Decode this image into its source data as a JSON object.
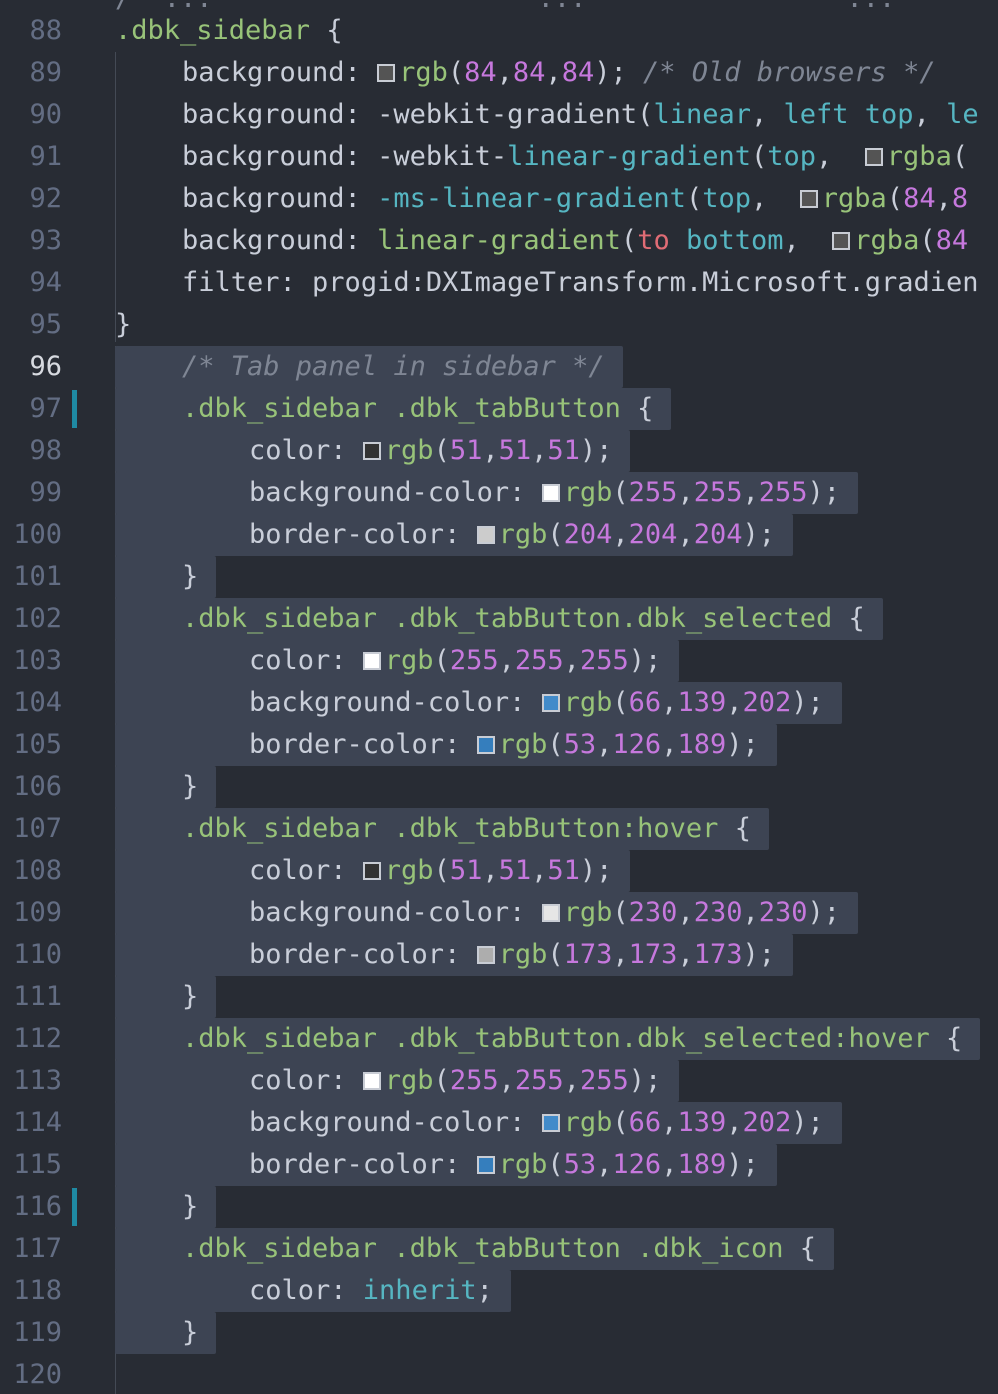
{
  "editor": {
    "top_partial_text": "/* ...                    ...                ...",
    "current_line": 96,
    "lines": [
      {
        "n": 88,
        "indent": 0,
        "sel": false,
        "mark": false,
        "tokens": [
          [
            "sel",
            ".dbk_sidebar"
          ],
          [
            "punc",
            " {"
          ]
        ]
      },
      {
        "n": 89,
        "indent": 1,
        "sel": false,
        "mark": false,
        "tokens": [
          [
            "prop",
            "background: "
          ],
          [
            "sw",
            "#545454"
          ],
          [
            "fn",
            "rgb"
          ],
          [
            "punc",
            "("
          ],
          [
            "num",
            "84"
          ],
          [
            "punc",
            ","
          ],
          [
            "num",
            "84"
          ],
          [
            "punc",
            ","
          ],
          [
            "num",
            "84"
          ],
          [
            "punc",
            ");"
          ],
          [
            "plain",
            " "
          ],
          [
            "cm",
            "/* Old browsers */"
          ]
        ]
      },
      {
        "n": 90,
        "indent": 1,
        "sel": false,
        "mark": false,
        "tokens": [
          [
            "prop",
            "background: "
          ],
          [
            "plain",
            "-webkit-gradient"
          ],
          [
            "punc",
            "("
          ],
          [
            "kw",
            "linear"
          ],
          [
            "punc",
            ", "
          ],
          [
            "kw",
            "left"
          ],
          [
            "plain",
            " "
          ],
          [
            "kw",
            "top"
          ],
          [
            "punc",
            ", "
          ],
          [
            "kw",
            "le"
          ]
        ]
      },
      {
        "n": 91,
        "indent": 1,
        "sel": false,
        "mark": false,
        "tokens": [
          [
            "prop",
            "background: "
          ],
          [
            "plain",
            "-webkit-"
          ],
          [
            "kw",
            "linear-gradient"
          ],
          [
            "punc",
            "("
          ],
          [
            "kw",
            "top"
          ],
          [
            "punc",
            ",  "
          ],
          [
            "sw",
            "#545454"
          ],
          [
            "fn",
            "rgba"
          ],
          [
            "punc",
            "("
          ]
        ]
      },
      {
        "n": 92,
        "indent": 1,
        "sel": false,
        "mark": false,
        "tokens": [
          [
            "prop",
            "background: "
          ],
          [
            "kw",
            "-ms-linear-gradient"
          ],
          [
            "punc",
            "("
          ],
          [
            "kw",
            "top"
          ],
          [
            "punc",
            ",  "
          ],
          [
            "sw",
            "#545454"
          ],
          [
            "fn",
            "rgba"
          ],
          [
            "punc",
            "("
          ],
          [
            "num",
            "84"
          ],
          [
            "punc",
            ","
          ],
          [
            "num",
            "8"
          ]
        ]
      },
      {
        "n": 93,
        "indent": 1,
        "sel": false,
        "mark": false,
        "tokens": [
          [
            "prop",
            "background: "
          ],
          [
            "fn",
            "linear-gradient"
          ],
          [
            "punc",
            "("
          ],
          [
            "to",
            "to"
          ],
          [
            "plain",
            " "
          ],
          [
            "kw",
            "bottom"
          ],
          [
            "punc",
            ",  "
          ],
          [
            "sw",
            "#545454"
          ],
          [
            "fn",
            "rgba"
          ],
          [
            "punc",
            "("
          ],
          [
            "num",
            "84"
          ]
        ]
      },
      {
        "n": 94,
        "indent": 1,
        "sel": false,
        "mark": false,
        "tokens": [
          [
            "prop",
            "filter: "
          ],
          [
            "plain",
            "progid:DXImageTransform.Microsoft.gradien"
          ]
        ]
      },
      {
        "n": 95,
        "indent": 0,
        "sel": false,
        "mark": false,
        "tokens": [
          [
            "punc",
            "}"
          ]
        ]
      },
      {
        "n": 96,
        "indent": 1,
        "sel": true,
        "mark": false,
        "tokens": [
          [
            "cm",
            "/* Tab panel in sidebar */"
          ]
        ]
      },
      {
        "n": 97,
        "indent": 1,
        "sel": true,
        "mark": true,
        "tokens": [
          [
            "sel",
            ".dbk_sidebar .dbk_tabButton"
          ],
          [
            "punc",
            " {"
          ]
        ]
      },
      {
        "n": 98,
        "indent": 2,
        "sel": true,
        "mark": false,
        "tokens": [
          [
            "prop",
            "color: "
          ],
          [
            "sw",
            "#333333"
          ],
          [
            "fn",
            "rgb"
          ],
          [
            "punc",
            "("
          ],
          [
            "num",
            "51"
          ],
          [
            "punc",
            ","
          ],
          [
            "num",
            "51"
          ],
          [
            "punc",
            ","
          ],
          [
            "num",
            "51"
          ],
          [
            "punc",
            ");"
          ]
        ]
      },
      {
        "n": 99,
        "indent": 2,
        "sel": true,
        "mark": false,
        "tokens": [
          [
            "prop",
            "background-color: "
          ],
          [
            "sw",
            "#ffffff"
          ],
          [
            "fn",
            "rgb"
          ],
          [
            "punc",
            "("
          ],
          [
            "num",
            "255"
          ],
          [
            "punc",
            ","
          ],
          [
            "num",
            "255"
          ],
          [
            "punc",
            ","
          ],
          [
            "num",
            "255"
          ],
          [
            "punc",
            ");"
          ]
        ]
      },
      {
        "n": 100,
        "indent": 2,
        "sel": true,
        "mark": false,
        "tokens": [
          [
            "prop",
            "border-color: "
          ],
          [
            "sw",
            "#cccccc"
          ],
          [
            "fn",
            "rgb"
          ],
          [
            "punc",
            "("
          ],
          [
            "num",
            "204"
          ],
          [
            "punc",
            ","
          ],
          [
            "num",
            "204"
          ],
          [
            "punc",
            ","
          ],
          [
            "num",
            "204"
          ],
          [
            "punc",
            ");"
          ]
        ]
      },
      {
        "n": 101,
        "indent": 1,
        "sel": true,
        "mark": false,
        "tokens": [
          [
            "punc",
            "}"
          ]
        ]
      },
      {
        "n": 102,
        "indent": 1,
        "sel": true,
        "mark": false,
        "tokens": [
          [
            "sel",
            ".dbk_sidebar .dbk_tabButton.dbk_selected"
          ],
          [
            "punc",
            " {"
          ]
        ]
      },
      {
        "n": 103,
        "indent": 2,
        "sel": true,
        "mark": false,
        "tokens": [
          [
            "prop",
            "color: "
          ],
          [
            "sw",
            "#ffffff"
          ],
          [
            "fn",
            "rgb"
          ],
          [
            "punc",
            "("
          ],
          [
            "num",
            "255"
          ],
          [
            "punc",
            ","
          ],
          [
            "num",
            "255"
          ],
          [
            "punc",
            ","
          ],
          [
            "num",
            "255"
          ],
          [
            "punc",
            ");"
          ]
        ]
      },
      {
        "n": 104,
        "indent": 2,
        "sel": true,
        "mark": false,
        "tokens": [
          [
            "prop",
            "background-color: "
          ],
          [
            "sw",
            "#428bca"
          ],
          [
            "fn",
            "rgb"
          ],
          [
            "punc",
            "("
          ],
          [
            "num",
            "66"
          ],
          [
            "punc",
            ","
          ],
          [
            "num",
            "139"
          ],
          [
            "punc",
            ","
          ],
          [
            "num",
            "202"
          ],
          [
            "punc",
            ");"
          ]
        ]
      },
      {
        "n": 105,
        "indent": 2,
        "sel": true,
        "mark": false,
        "tokens": [
          [
            "prop",
            "border-color: "
          ],
          [
            "sw",
            "#357ebd"
          ],
          [
            "fn",
            "rgb"
          ],
          [
            "punc",
            "("
          ],
          [
            "num",
            "53"
          ],
          [
            "punc",
            ","
          ],
          [
            "num",
            "126"
          ],
          [
            "punc",
            ","
          ],
          [
            "num",
            "189"
          ],
          [
            "punc",
            ");"
          ]
        ]
      },
      {
        "n": 106,
        "indent": 1,
        "sel": true,
        "mark": false,
        "tokens": [
          [
            "punc",
            "}"
          ]
        ]
      },
      {
        "n": 107,
        "indent": 1,
        "sel": true,
        "mark": false,
        "tokens": [
          [
            "sel",
            ".dbk_sidebar .dbk_tabButton:hover"
          ],
          [
            "punc",
            " {"
          ]
        ]
      },
      {
        "n": 108,
        "indent": 2,
        "sel": true,
        "mark": false,
        "tokens": [
          [
            "prop",
            "color: "
          ],
          [
            "sw",
            "#333333"
          ],
          [
            "fn",
            "rgb"
          ],
          [
            "punc",
            "("
          ],
          [
            "num",
            "51"
          ],
          [
            "punc",
            ","
          ],
          [
            "num",
            "51"
          ],
          [
            "punc",
            ","
          ],
          [
            "num",
            "51"
          ],
          [
            "punc",
            ");"
          ]
        ]
      },
      {
        "n": 109,
        "indent": 2,
        "sel": true,
        "mark": false,
        "tokens": [
          [
            "prop",
            "background-color: "
          ],
          [
            "sw",
            "#e6e6e6"
          ],
          [
            "fn",
            "rgb"
          ],
          [
            "punc",
            "("
          ],
          [
            "num",
            "230"
          ],
          [
            "punc",
            ","
          ],
          [
            "num",
            "230"
          ],
          [
            "punc",
            ","
          ],
          [
            "num",
            "230"
          ],
          [
            "punc",
            ");"
          ]
        ]
      },
      {
        "n": 110,
        "indent": 2,
        "sel": true,
        "mark": false,
        "tokens": [
          [
            "prop",
            "border-color: "
          ],
          [
            "sw",
            "#adadad"
          ],
          [
            "fn",
            "rgb"
          ],
          [
            "punc",
            "("
          ],
          [
            "num",
            "173"
          ],
          [
            "punc",
            ","
          ],
          [
            "num",
            "173"
          ],
          [
            "punc",
            ","
          ],
          [
            "num",
            "173"
          ],
          [
            "punc",
            ");"
          ]
        ]
      },
      {
        "n": 111,
        "indent": 1,
        "sel": true,
        "mark": false,
        "tokens": [
          [
            "punc",
            "}"
          ]
        ]
      },
      {
        "n": 112,
        "indent": 1,
        "sel": true,
        "mark": false,
        "tokens": [
          [
            "sel",
            ".dbk_sidebar .dbk_tabButton.dbk_selected:hover"
          ],
          [
            "punc",
            " {"
          ]
        ]
      },
      {
        "n": 113,
        "indent": 2,
        "sel": true,
        "mark": false,
        "tokens": [
          [
            "prop",
            "color: "
          ],
          [
            "sw",
            "#ffffff"
          ],
          [
            "fn",
            "rgb"
          ],
          [
            "punc",
            "("
          ],
          [
            "num",
            "255"
          ],
          [
            "punc",
            ","
          ],
          [
            "num",
            "255"
          ],
          [
            "punc",
            ","
          ],
          [
            "num",
            "255"
          ],
          [
            "punc",
            ");"
          ]
        ]
      },
      {
        "n": 114,
        "indent": 2,
        "sel": true,
        "mark": false,
        "tokens": [
          [
            "prop",
            "background-color: "
          ],
          [
            "sw",
            "#428bca"
          ],
          [
            "fn",
            "rgb"
          ],
          [
            "punc",
            "("
          ],
          [
            "num",
            "66"
          ],
          [
            "punc",
            ","
          ],
          [
            "num",
            "139"
          ],
          [
            "punc",
            ","
          ],
          [
            "num",
            "202"
          ],
          [
            "punc",
            ");"
          ]
        ]
      },
      {
        "n": 115,
        "indent": 2,
        "sel": true,
        "mark": false,
        "tokens": [
          [
            "prop",
            "border-color: "
          ],
          [
            "sw",
            "#357ebd"
          ],
          [
            "fn",
            "rgb"
          ],
          [
            "punc",
            "("
          ],
          [
            "num",
            "53"
          ],
          [
            "punc",
            ","
          ],
          [
            "num",
            "126"
          ],
          [
            "punc",
            ","
          ],
          [
            "num",
            "189"
          ],
          [
            "punc",
            ");"
          ]
        ]
      },
      {
        "n": 116,
        "indent": 1,
        "sel": true,
        "mark": true,
        "tokens": [
          [
            "punc",
            "}"
          ]
        ]
      },
      {
        "n": 117,
        "indent": 1,
        "sel": true,
        "mark": false,
        "tokens": [
          [
            "sel",
            ".dbk_sidebar .dbk_tabButton .dbk_icon"
          ],
          [
            "punc",
            " {"
          ]
        ]
      },
      {
        "n": 118,
        "indent": 2,
        "sel": true,
        "mark": false,
        "tokens": [
          [
            "prop",
            "color: "
          ],
          [
            "kw",
            "inherit"
          ],
          [
            "punc",
            ";"
          ]
        ]
      },
      {
        "n": 119,
        "indent": 1,
        "sel": true,
        "mark": false,
        "tokens": [
          [
            "punc",
            "}"
          ]
        ]
      },
      {
        "n": 120,
        "indent": 0,
        "sel": false,
        "mark": false,
        "tokens": []
      }
    ]
  }
}
